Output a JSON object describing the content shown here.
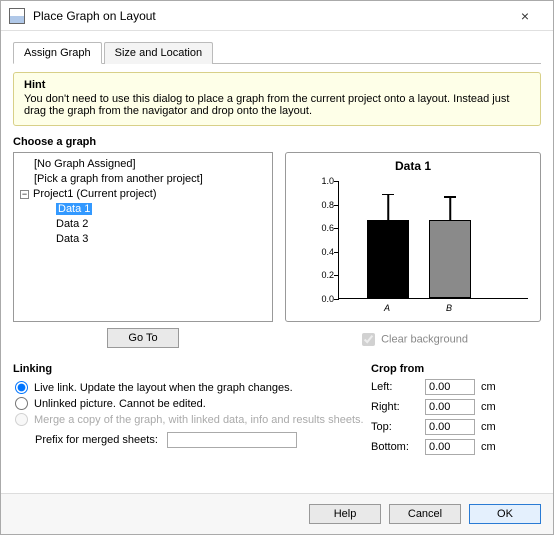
{
  "window": {
    "title": "Place Graph on Layout"
  },
  "tabs": {
    "assign": "Assign Graph",
    "size": "Size and Location"
  },
  "hint": {
    "title": "Hint",
    "body": "You don't need to use this dialog to place a graph from the current project onto a layout. Instead just drag the graph from the navigator and drop onto the layout."
  },
  "choose": {
    "title": "Choose a graph",
    "tree": {
      "no_assigned": "[No Graph Assigned]",
      "pick_other": "[Pick a graph from another project]",
      "project": "Project1 (Current project)",
      "items": [
        "Data 1",
        "Data 2",
        "Data 3"
      ],
      "selected": "Data 1"
    },
    "goto": "Go To",
    "clear_bg": "Clear background"
  },
  "chart_data": {
    "type": "bar",
    "title": "Data 1",
    "categories": [
      "A",
      "B"
    ],
    "series": [
      {
        "name": "A",
        "value": 0.66,
        "err": 0.21,
        "color": "#000000"
      },
      {
        "name": "B",
        "value": 0.66,
        "err": 0.19,
        "color": "#8a8a8a"
      }
    ],
    "yticks": [
      0.0,
      0.2,
      0.4,
      0.6,
      0.8,
      1.0
    ],
    "ylim": [
      0,
      1.0
    ]
  },
  "linking": {
    "title": "Linking",
    "live": "Live link. Update the layout when the graph changes.",
    "unlinked": "Unlinked picture. Cannot be edited.",
    "merge": "Merge a copy of the graph, with linked data, info and results sheets.",
    "prefix_label": "Prefix for merged sheets:",
    "prefix_value": ""
  },
  "crop": {
    "title": "Crop from",
    "left_label": "Left:",
    "right_label": "Right:",
    "top_label": "Top:",
    "bottom_label": "Bottom:",
    "left": "0.00",
    "right": "0.00",
    "top": "0.00",
    "bottom": "0.00",
    "unit": "cm"
  },
  "footer": {
    "help": "Help",
    "cancel": "Cancel",
    "ok": "OK"
  }
}
